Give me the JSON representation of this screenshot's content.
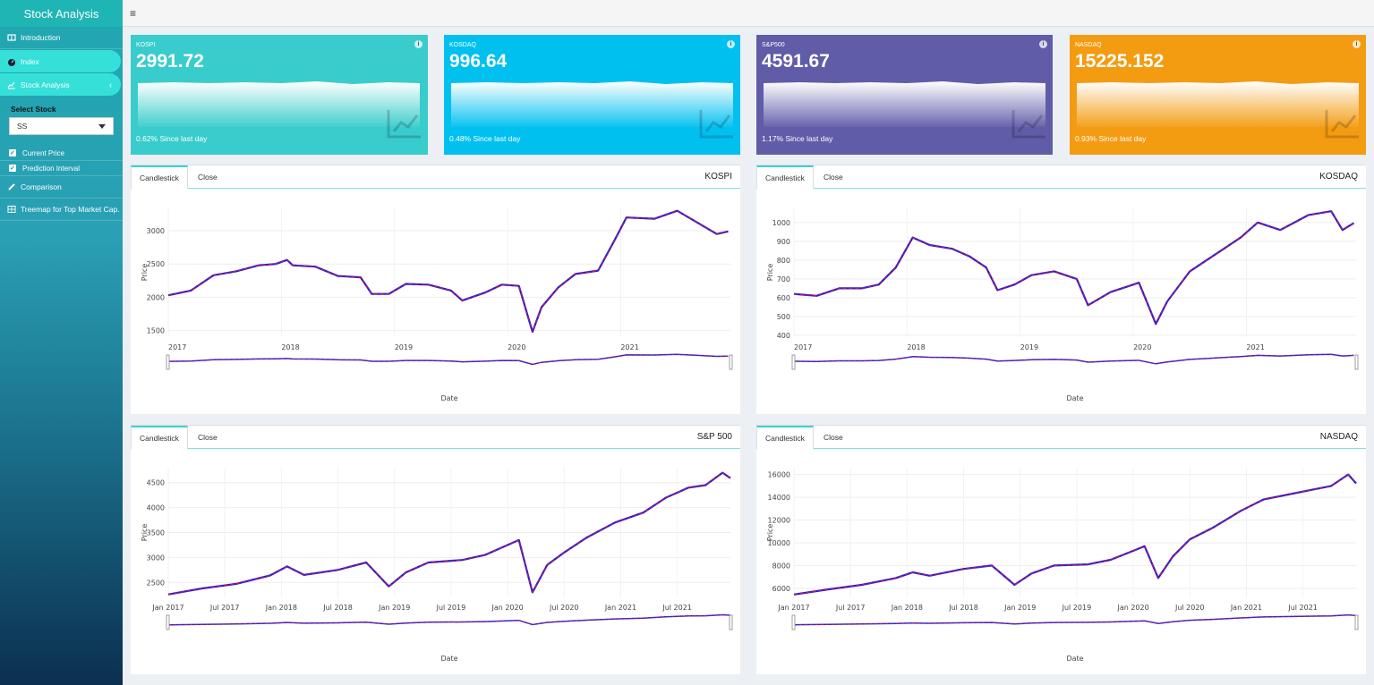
{
  "sidebar": {
    "brand": "Stock Analysis",
    "items": [
      {
        "label": "Introduction",
        "icon": "book-icon"
      },
      {
        "label": "Index",
        "icon": "dashboard-icon"
      },
      {
        "label": "Stock Analysis",
        "icon": "line-chart-icon"
      }
    ],
    "select_stock_label": "Select Stock",
    "select_stock_value": "SS",
    "checks": [
      "Current Price",
      "Prediction Interval"
    ],
    "more_items": [
      {
        "label": "Comparison",
        "icon": "pencil-icon"
      },
      {
        "label": "Treemap for Top Market Cap.",
        "icon": "table-icon"
      }
    ]
  },
  "header": {
    "menu_icon": "hamburger-icon"
  },
  "value_boxes": [
    {
      "label": "KOSPI",
      "value": "2991.72",
      "footer": "0.62% Since last day",
      "color": "#39cccc"
    },
    {
      "label": "KOSDAQ",
      "value": "996.64",
      "footer": "0.48% Since last day",
      "color": "#00c0ef"
    },
    {
      "label": "S&P500",
      "value": "4591.67",
      "footer": "1.17% Since last day",
      "color": "#605ca8"
    },
    {
      "label": "NASDAQ",
      "value": "15225.152",
      "footer": "0.93% Since last day",
      "color": "#f39c12"
    }
  ],
  "panels": [
    {
      "title": "KOSPI",
      "tabs": [
        "Candlestick",
        "Close"
      ],
      "xlabel": "Date",
      "ylabel": "Price"
    },
    {
      "title": "KOSDAQ",
      "tabs": [
        "Candlestick",
        "Close"
      ],
      "xlabel": "Date",
      "ylabel": "Price"
    },
    {
      "title": "S&P 500",
      "tabs": [
        "Candlestick",
        "Close"
      ],
      "xlabel": "Date",
      "ylabel": "Price"
    },
    {
      "title": "NASDAQ",
      "tabs": [
        "Candlestick",
        "Close"
      ],
      "xlabel": "Date",
      "ylabel": "Price"
    }
  ],
  "chart_data": [
    {
      "type": "line",
      "title": "KOSPI",
      "xlabel": "Date",
      "ylabel": "Price",
      "x_ticks": [
        "2017",
        "2018",
        "2019",
        "2020",
        "2021"
      ],
      "y_ticks": [
        1500,
        2000,
        2500,
        3000
      ],
      "ylim": [
        1400,
        3350
      ],
      "series": [
        {
          "points": [
            [
              2017.0,
              2030
            ],
            [
              2017.2,
              2100
            ],
            [
              2017.4,
              2330
            ],
            [
              2017.6,
              2390
            ],
            [
              2017.8,
              2480
            ],
            [
              2017.95,
              2500
            ],
            [
              2018.05,
              2560
            ],
            [
              2018.1,
              2480
            ],
            [
              2018.3,
              2460
            ],
            [
              2018.5,
              2320
            ],
            [
              2018.7,
              2300
            ],
            [
              2018.8,
              2050
            ],
            [
              2018.95,
              2050
            ],
            [
              2019.1,
              2200
            ],
            [
              2019.3,
              2190
            ],
            [
              2019.5,
              2100
            ],
            [
              2019.6,
              1950
            ],
            [
              2019.8,
              2070
            ],
            [
              2019.95,
              2190
            ],
            [
              2020.1,
              2170
            ],
            [
              2020.22,
              1480
            ],
            [
              2020.3,
              1850
            ],
            [
              2020.45,
              2150
            ],
            [
              2020.6,
              2350
            ],
            [
              2020.8,
              2400
            ],
            [
              2020.95,
              2870
            ],
            [
              2021.05,
              3200
            ],
            [
              2021.3,
              3180
            ],
            [
              2021.5,
              3300
            ],
            [
              2021.7,
              3100
            ],
            [
              2021.85,
              2950
            ],
            [
              2021.95,
              2990
            ]
          ]
        }
      ]
    },
    {
      "type": "line",
      "title": "KOSDAQ",
      "xlabel": "Date",
      "ylabel": "Price",
      "x_ticks": [
        "2017",
        "2018",
        "2019",
        "2020",
        "2021"
      ],
      "y_ticks": [
        400,
        500,
        600,
        700,
        800,
        900,
        1000
      ],
      "ylim": [
        390,
        1080
      ],
      "series": [
        {
          "points": [
            [
              2017.0,
              620
            ],
            [
              2017.2,
              610
            ],
            [
              2017.4,
              650
            ],
            [
              2017.6,
              650
            ],
            [
              2017.75,
              670
            ],
            [
              2017.9,
              760
            ],
            [
              2018.05,
              920
            ],
            [
              2018.2,
              880
            ],
            [
              2018.4,
              860
            ],
            [
              2018.55,
              820
            ],
            [
              2018.7,
              760
            ],
            [
              2018.8,
              640
            ],
            [
              2018.95,
              670
            ],
            [
              2019.1,
              720
            ],
            [
              2019.3,
              740
            ],
            [
              2019.5,
              700
            ],
            [
              2019.6,
              560
            ],
            [
              2019.8,
              630
            ],
            [
              2019.95,
              660
            ],
            [
              2020.05,
              680
            ],
            [
              2020.2,
              460
            ],
            [
              2020.3,
              580
            ],
            [
              2020.5,
              740
            ],
            [
              2020.65,
              800
            ],
            [
              2020.8,
              860
            ],
            [
              2020.95,
              920
            ],
            [
              2021.1,
              1000
            ],
            [
              2021.3,
              960
            ],
            [
              2021.55,
              1040
            ],
            [
              2021.75,
              1060
            ],
            [
              2021.85,
              960
            ],
            [
              2021.95,
              997
            ]
          ]
        }
      ]
    },
    {
      "type": "line",
      "title": "S&P 500",
      "xlabel": "Date",
      "ylabel": "Price",
      "x_ticks": [
        "Jan 2017",
        "Jul 2017",
        "Jan 2018",
        "Jul 2018",
        "Jan 2019",
        "Jul 2019",
        "Jan 2020",
        "Jul 2020",
        "Jan 2021",
        "Jul 2021"
      ],
      "y_ticks": [
        2500,
        3000,
        3500,
        4000,
        4500
      ],
      "ylim": [
        2200,
        4800
      ],
      "series": [
        {
          "points": [
            [
              2017.0,
              2260
            ],
            [
              2017.3,
              2380
            ],
            [
              2017.6,
              2470
            ],
            [
              2017.9,
              2640
            ],
            [
              2018.05,
              2820
            ],
            [
              2018.2,
              2650
            ],
            [
              2018.5,
              2750
            ],
            [
              2018.75,
              2900
            ],
            [
              2018.95,
              2420
            ],
            [
              2019.1,
              2700
            ],
            [
              2019.3,
              2900
            ],
            [
              2019.6,
              2950
            ],
            [
              2019.8,
              3050
            ],
            [
              2020.1,
              3350
            ],
            [
              2020.22,
              2300
            ],
            [
              2020.35,
              2850
            ],
            [
              2020.5,
              3100
            ],
            [
              2020.7,
              3400
            ],
            [
              2020.95,
              3700
            ],
            [
              2021.2,
              3900
            ],
            [
              2021.4,
              4200
            ],
            [
              2021.6,
              4400
            ],
            [
              2021.75,
              4450
            ],
            [
              2021.9,
              4700
            ],
            [
              2021.97,
              4590
            ]
          ]
        }
      ]
    },
    {
      "type": "line",
      "title": "NASDAQ",
      "xlabel": "Date",
      "ylabel": "Price",
      "x_ticks": [
        "Jan 2017",
        "Jul 2017",
        "Jan 2018",
        "Jul 2018",
        "Jan 2019",
        "Jul 2019",
        "Jan 2020",
        "Jul 2020",
        "Jan 2021",
        "Jul 2021"
      ],
      "y_ticks": [
        6000,
        8000,
        10000,
        12000,
        14000,
        16000
      ],
      "ylim": [
        5200,
        16600
      ],
      "series": [
        {
          "points": [
            [
              2017.0,
              5450
            ],
            [
              2017.3,
              5900
            ],
            [
              2017.6,
              6300
            ],
            [
              2017.9,
              6900
            ],
            [
              2018.05,
              7400
            ],
            [
              2018.2,
              7100
            ],
            [
              2018.5,
              7700
            ],
            [
              2018.75,
              8000
            ],
            [
              2018.95,
              6300
            ],
            [
              2019.1,
              7300
            ],
            [
              2019.3,
              8000
            ],
            [
              2019.6,
              8100
            ],
            [
              2019.8,
              8500
            ],
            [
              2020.1,
              9700
            ],
            [
              2020.22,
              6900
            ],
            [
              2020.35,
              8800
            ],
            [
              2020.5,
              10300
            ],
            [
              2020.7,
              11300
            ],
            [
              2020.95,
              12800
            ],
            [
              2021.15,
              13800
            ],
            [
              2021.35,
              14200
            ],
            [
              2021.6,
              14700
            ],
            [
              2021.75,
              15000
            ],
            [
              2021.9,
              16000
            ],
            [
              2021.97,
              15225
            ]
          ]
        }
      ]
    }
  ]
}
